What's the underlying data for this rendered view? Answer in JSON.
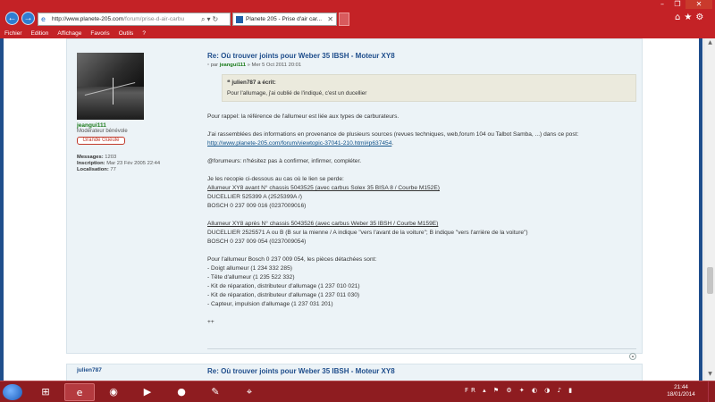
{
  "browser": {
    "address_url": "http://www.planete-205.com",
    "address_url_rest": "/forum/prise-d-air-carbu",
    "tab_title": "Planete 205 - Prise d'air car...",
    "window_controls": {
      "minimize": "–",
      "maximize": "❐",
      "close": "✕"
    },
    "toolbar_icons": "⌂★⚙",
    "menu": [
      "Fichier",
      "Edition",
      "Affichage",
      "Favoris",
      "Outils",
      "?"
    ]
  },
  "post": {
    "title": "Re: Où trouver joints pour Weber 35 IBSH - Moteur XY8",
    "byline_prefix": "par",
    "byline_user": "jeangui111",
    "byline_date": "» Mer 5 Oct 2011 20:01",
    "author": {
      "username": "jeangui111",
      "role": "Modérateur bénévole",
      "rank": "Grande Gueule",
      "messages_label": "Messages:",
      "messages": "1203",
      "inscription_label": "Inscription:",
      "inscription": "Mar 23 Fév 2005 22:44",
      "localisation_label": "Localisation:",
      "localisation": "77"
    },
    "quote": {
      "author": "julien787 a écrit:",
      "text": "Pour l'allumage, j'ai oublié de l'indiqué, c'est un ducellier"
    },
    "body": {
      "p1": "Pour rappel: la référence de l'allumeur est liée aux types de carburateurs.",
      "p2_text": "J'ai rassemblées des informations en provenance de plusieurs sources (revues techniques, web,forum 104 ou Talbot Samba, ...) dans ce post:",
      "p2_link": "http://www.planete-205.com/forum/viewtopic-37041-210.html#p637454",
      "p2_end": ".",
      "p3": "@forumeurs: n'hésitez pas à confirmer, infirmer, compléter.",
      "p4_intro": "Je les recopie ci-dessous au cas où le lien se perde:",
      "avant_title": "Allumeur XY8 avant N° chassis 5043525 (avec carbus Solex 35 BISA 8 / Courbe M152E)",
      "avant_l1": "DUCELLIER 525399 A (2525399A /)",
      "avant_l2": "BOSCH 0 237 009 016 (0237009016)",
      "apres_title": "Allumeur XY8 après N° chassis 5043526 (avec carbus Weber 35 IBSH / Courbe M159E)",
      "apres_l1": "DUCELLIER 2525571 A ou B (B sur la mienne / A indique \"vers l'avant de la voiture\"; B indique \"vers l'arrière de la voiture\")",
      "apres_l2": "BOSCH 0 237 009 054 (0237009054)",
      "pieces_intro": "Pour l'allumeur Bosch 0 237 009 054, les pièces détachées sont:",
      "pieces": [
        "- Doigt allumeur (1 234 332 285)",
        "- Tête d'allumeur (1 235 522 332)",
        "- Kit de réparation, distributeur d'allumage (1 237 010 021)",
        "- Kit de réparation, distributeur d'allumage (1 237 011 030)",
        "- Capteur, impulsion d'allumage (1 237 031 201)"
      ],
      "signoff": "++"
    }
  },
  "post2": {
    "username": "julien787",
    "title": "Re: Où trouver joints pour Weber 35 IBSH - Moteur XY8"
  },
  "taskbar": {
    "apps": [
      "⊞",
      "e",
      "◉",
      "▶",
      "●",
      "✎",
      "⌖"
    ],
    "tray": "FR ▴ ⚑ ⚙ ✦ ◐ ◑ ♪ ▮",
    "time": "21:44",
    "date": "18/01/2014"
  },
  "colors": {
    "chrome": "#c42226",
    "taskbar": "#8e1c20",
    "post_bg": "#ecf3f7",
    "title_blue": "#1f4e8c",
    "username_green": "#1a7a1a"
  }
}
